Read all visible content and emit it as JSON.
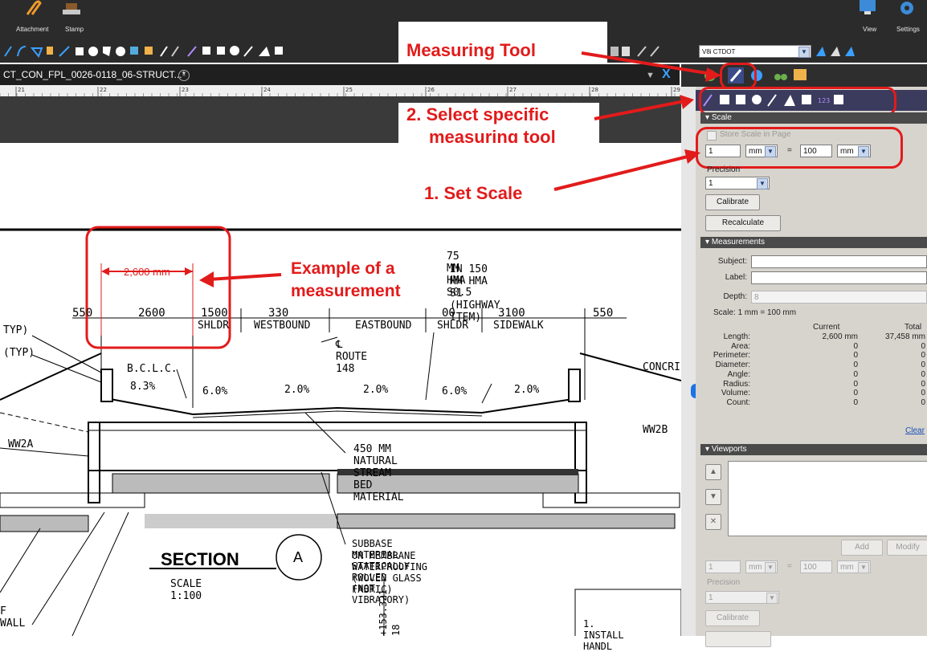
{
  "toolbar": {
    "attachment_label": "Attachment",
    "stamp_label": "Stamp",
    "view_label": "View",
    "settings_label": "Settings",
    "profile_value": "V8i CTDOT"
  },
  "document": {
    "tab_title": "CT_CON_FPL_0026-0118_06-STRUCT...*",
    "ruler_marks": [
      "21",
      "22",
      "23",
      "24",
      "25",
      "26",
      "27",
      "28",
      "29"
    ]
  },
  "annotations": {
    "measuring_tool": "Measuring Tool",
    "select_tool_line1": "2. Select specific",
    "select_tool_line2": "measuring tool",
    "set_scale": "1. Set Scale",
    "example_line1": "Example of a",
    "example_line2": "measurement",
    "measurement_label": "2,600 mm"
  },
  "drawing": {
    "note_top1": "75 MM HMA S0.5",
    "note_top2": "IN 150 MM HMA S1 (HIGHWAY ITEM)",
    "dims": [
      "550",
      "2600",
      "1500",
      "330",
      "00",
      "3100",
      "550"
    ],
    "lane_labels": [
      "SHLDR",
      "WESTBOUND",
      "EASTBOUND",
      "SHLDR",
      "SIDEWALK"
    ],
    "route_label": "℄ ROUTE 148",
    "bclc": "B.C.L.C.",
    "slopes": [
      "8.3%",
      "6.0%",
      "2.0%",
      "2.0%",
      "6.0%",
      "2.0%"
    ],
    "typ1": "TYP)",
    "typ2": "(TYP)",
    "concr": "CONCRI",
    "ww2a": "WW2A",
    "ww2b": "WW2B",
    "stream_bed": "450 MM NATURAL STREAM BED MATERIAL",
    "subbase1": "SUBBASE MATERIAL STATICALLY ROLLED (NOT VIBRATORY)",
    "subbase2": "ON MEMBRANE WATERPROOFING (WOVEN GLASS FABRIC)",
    "section_title": "SECTION",
    "section_letter": "A",
    "section_scale": "SCALE 1:100",
    "wall": "F WALL",
    "elevation": "+153.321",
    "elev2": "18",
    "install": "1. INSTALL HANDL"
  },
  "panel": {
    "scale_header": "Scale",
    "store_scale": "Store Scale in Page",
    "scale_left_value": "1",
    "scale_left_unit": "mm",
    "equals": "=",
    "scale_right_value": "100",
    "scale_right_unit": "mm",
    "precision_label": "Precision",
    "precision_value": "1",
    "calibrate": "Calibrate",
    "recalculate": "Recalculate",
    "measurements_header": "Measurements",
    "subject_label": "Subject:",
    "label_label": "Label:",
    "depth_label": "Depth:",
    "depth_value": "8",
    "scale_text": "Scale:  1 mm = 100 mm",
    "col_current": "Current",
    "col_total": "Total",
    "rows": [
      {
        "name": "Length:",
        "current": "2,600 mm",
        "total": "37,458 mm"
      },
      {
        "name": "Area:",
        "current": "0",
        "total": "0"
      },
      {
        "name": "Perimeter:",
        "current": "0",
        "total": "0"
      },
      {
        "name": "Diameter:",
        "current": "0",
        "total": "0"
      },
      {
        "name": "Angle:",
        "current": "0",
        "total": "0"
      },
      {
        "name": "Radius:",
        "current": "0",
        "total": "0"
      },
      {
        "name": "Volume:",
        "current": "0",
        "total": "0"
      },
      {
        "name": "Count:",
        "current": "0",
        "total": "0"
      }
    ],
    "clear": "Clear",
    "viewports_header": "Viewports",
    "add": "Add",
    "modify": "Modify",
    "vp_left_value": "1",
    "vp_left_unit": "mm",
    "vp_right_value": "100",
    "vp_right_unit": "mm",
    "vp_precision_label": "Precision",
    "vp_precision_value": "1",
    "vp_calibrate": "Calibrate"
  },
  "colors": {
    "callout_red": "#e21b1b",
    "panel_bg": "#d7d4cd",
    "toolbar_bg": "#2b2b2b"
  }
}
